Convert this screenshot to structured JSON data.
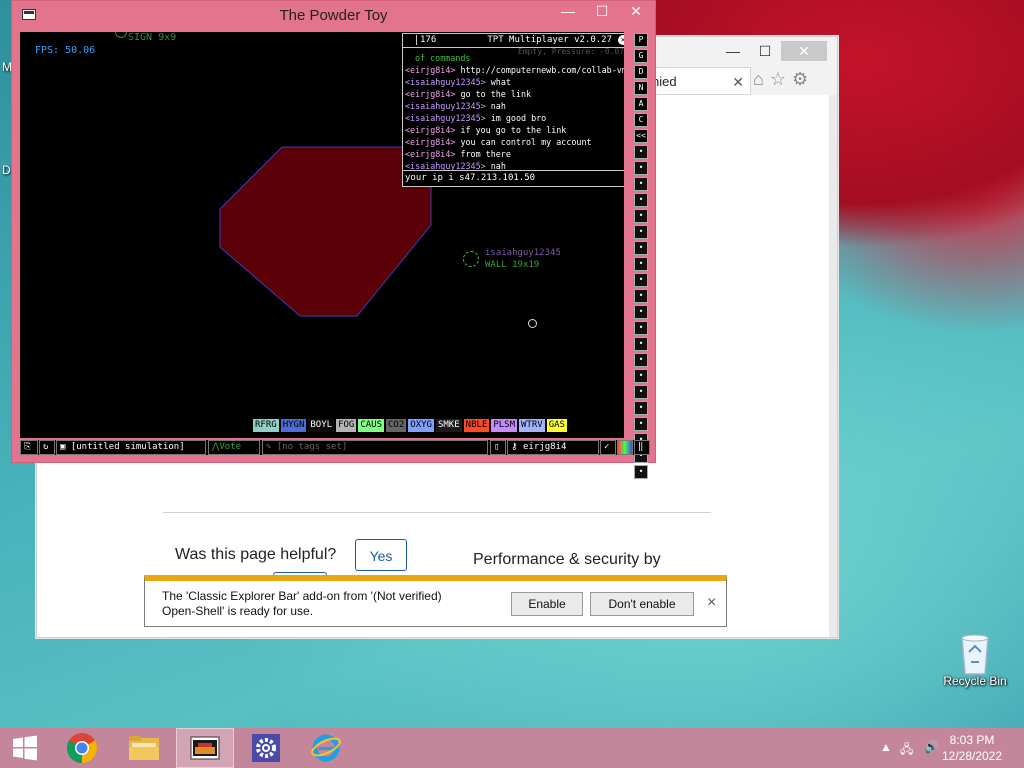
{
  "desktop": {
    "recycle_bin_label": "Recycle Bin",
    "edge_letters": [
      "M",
      "D"
    ]
  },
  "browser": {
    "tab_title": "nied",
    "helpful_question": "Was this page helpful?",
    "yes_label": "Yes",
    "performance_text": "Performance & security by"
  },
  "notification": {
    "message_line1": "The 'Classic Explorer Bar' add-on from '(Not verified)",
    "message_line2": "Open-Shell' is ready for use.",
    "enable_label": "Enable",
    "dont_enable_label": "Don't enable",
    "close_symbol": "×"
  },
  "tpt": {
    "window_title": "The Powder Toy",
    "fps": "FPS: 50.06",
    "sign_text": "SIGN 9x9",
    "player_name": "isaiahguy12345",
    "player_wall": "WALL 19x19",
    "chat": {
      "count": "176",
      "version": "TPT Multiplayer v2.0.27",
      "info": "Empty, Pressure: -0.07",
      "lines": [
        {
          "user": "",
          "text": "of commands",
          "cls": "sys"
        },
        {
          "user": "eirjg8i4",
          "text": " http://computernewb.com/collab-vm",
          "cls": "u1"
        },
        {
          "user": "isaiahguy12345",
          "text": " what",
          "cls": "u2"
        },
        {
          "user": "eirjg8i4",
          "text": " go to the link",
          "cls": "u1"
        },
        {
          "user": "isaiahguy12345",
          "text": " nah",
          "cls": "u2"
        },
        {
          "user": "isaiahguy12345",
          "text": " im good bro",
          "cls": "u2"
        },
        {
          "user": "eirjg8i4",
          "text": " if you go to the link",
          "cls": "u1"
        },
        {
          "user": "eirjg8i4",
          "text": " you can control my account",
          "cls": "u1"
        },
        {
          "user": "eirjg8i4",
          "text": " from there",
          "cls": "u1"
        },
        {
          "user": "isaiahguy12345",
          "text": " nah",
          "cls": "u2"
        }
      ],
      "input_text": "your ip i s47.213.101.50"
    },
    "elements": [
      {
        "label": "RFRG",
        "color": "#8fd1c5"
      },
      {
        "label": "HYGN",
        "color": "#4f6dd9"
      },
      {
        "label": "BOYL",
        "color": "#0d0d0d",
        "text": "#ffffff"
      },
      {
        "label": "FOG",
        "color": "#b5b5b5"
      },
      {
        "label": "CAUS",
        "color": "#80ff80"
      },
      {
        "label": "CO2",
        "color": "#666666"
      },
      {
        "label": "OXYG",
        "color": "#7fa0ff"
      },
      {
        "label": "SMKE",
        "color": "#1a1a1a",
        "text": "#ffffff"
      },
      {
        "label": "NBLE",
        "color": "#ff4a23"
      },
      {
        "label": "PLSM",
        "color": "#c68bff"
      },
      {
        "label": "WTRV",
        "color": "#a3b4ff"
      },
      {
        "label": "GAS",
        "color": "#ffff33"
      }
    ],
    "right_letters": [
      "P",
      "G",
      "D",
      "N",
      "A",
      "C",
      "<<"
    ],
    "right_icons": [
      "H",
      "M",
      "B",
      "O",
      "S",
      "L",
      "C",
      "P",
      "F",
      "W",
      "K",
      "R",
      "T",
      "E",
      "A",
      "X",
      "G",
      "U",
      "I",
      "V",
      "Q"
    ],
    "bottom": {
      "sim_name": "[untitled simulation]",
      "vote": "Vote",
      "tags": "[no tags set]",
      "username": "eirjg8i4"
    }
  },
  "taskbar": {
    "time": "8:03 PM",
    "date": "12/28/2022"
  }
}
